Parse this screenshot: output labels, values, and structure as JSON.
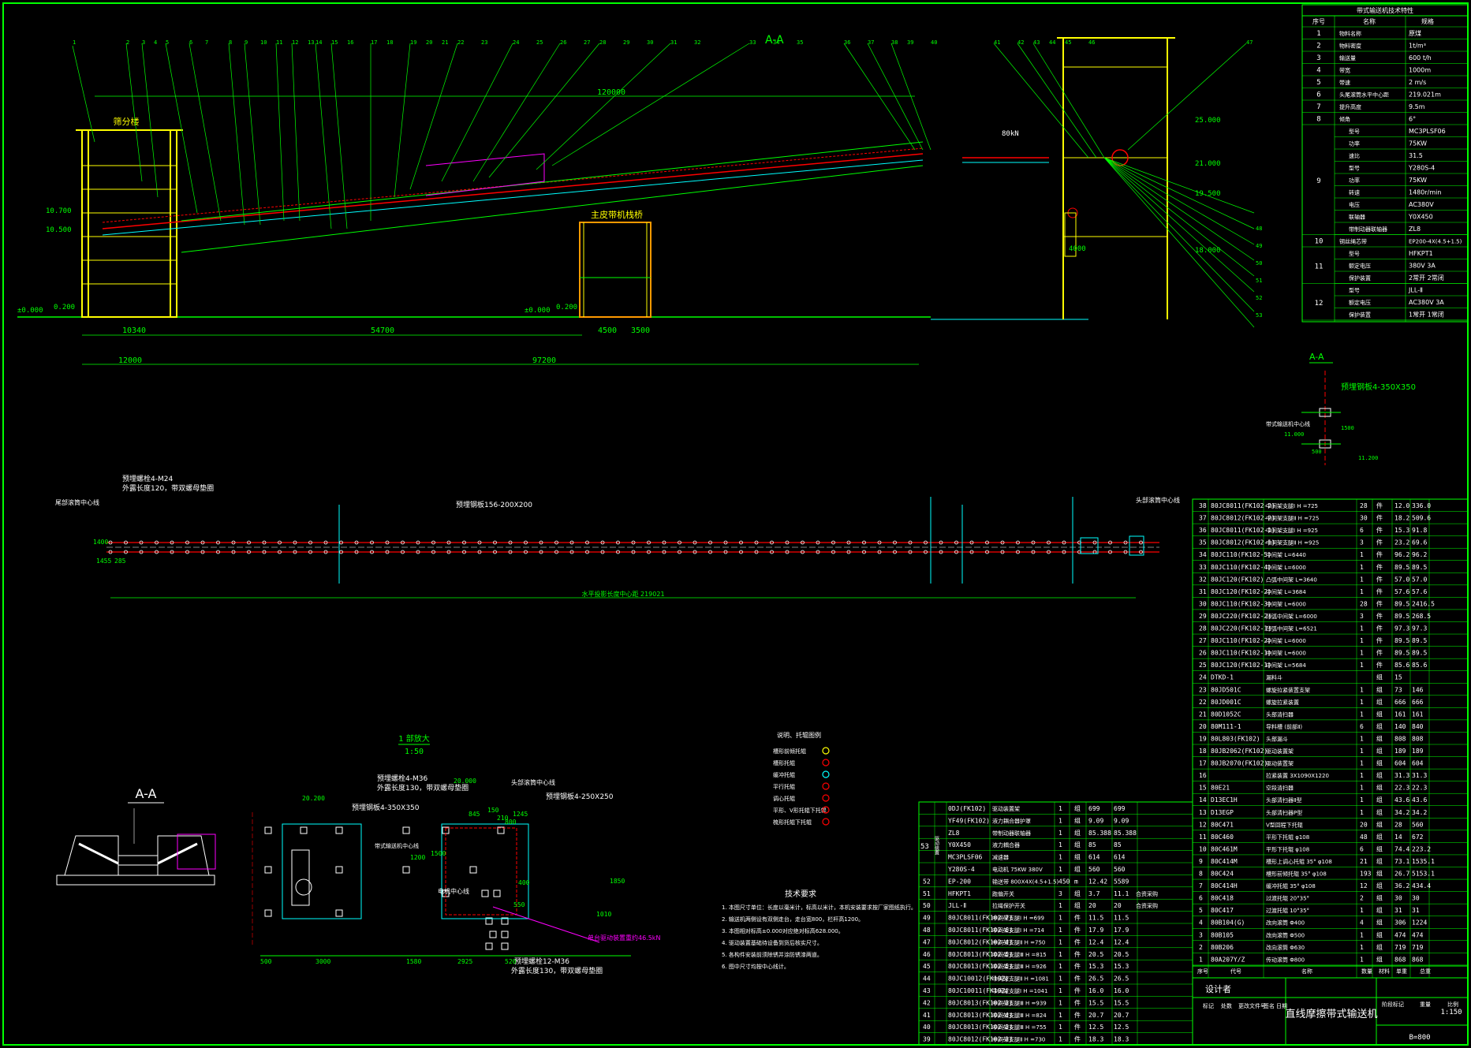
{
  "colors": {
    "background": "#000000",
    "green": "#00ff00",
    "yellow": "#ffff00",
    "cyan": "#00ffff",
    "red": "#ff0000",
    "white": "#ffffff",
    "magenta": "#ff00ff",
    "olive": "#c8c800",
    "orange": "#ff9900"
  },
  "elevation": {
    "section_label": "A-A",
    "dim_total": "120000",
    "load_label": "80kN",
    "floor_left": "±0.000",
    "floor_left2": "0.200",
    "floor_mid": "±0.000",
    "floor_mid2": "0.200",
    "elev_a": "10.700",
    "elev_b": "10.500",
    "elev_top": "25.000",
    "elev_r1": "21.000",
    "elev_r2": "19.500",
    "elev_r3": "18.000",
    "building_label": "筛分楼",
    "support_label": "主皮带机栈桥",
    "dim_10340": "10340",
    "dim_54700": "54700",
    "dim_4500": "4500",
    "dim_3500": "3500",
    "dim_12000": "12000",
    "dim_97200": "97200",
    "dim_4000": "4000",
    "callouts_top": [
      "1",
      "2",
      "3",
      "4",
      "5",
      "6",
      "7",
      "8",
      "9",
      "10",
      "11",
      "12",
      "13",
      "14",
      "15",
      "16",
      "17",
      "18",
      "19",
      "20",
      "21",
      "22",
      "23",
      "24",
      "25",
      "26",
      "27",
      "28",
      "29",
      "30",
      "31",
      "32",
      "33",
      "34",
      "35",
      "36",
      "37",
      "38",
      "39",
      "40",
      "41",
      "42",
      "43",
      "44",
      "45",
      "46",
      "47",
      "48",
      "49",
      "50",
      "51",
      "52",
      "53"
    ]
  },
  "plan": {
    "bolt_label": "预埋螺栓4-M24",
    "bolt_note": "外露长度120，带双螺母垫圈",
    "plate_label": "预埋钢板156-200X200",
    "left_center": "尾部滚筒中心线",
    "right_center": "头部滚筒中心线",
    "dim_total": "水平投影长度中心距 219021",
    "dim_1400": "1400",
    "dim_1455": "1455",
    "dim_285": "285"
  },
  "section_small": {
    "title": "A-A",
    "plate": "预埋钢板4-350X350",
    "center": "带式输送机中心线",
    "elev1": "11.000",
    "elev2": "11.200",
    "dim1500": "1500",
    "dim500": "500"
  },
  "details": {
    "aa_title": "A-A",
    "scale_title": "1 部放大",
    "scale": "1:50",
    "bolt_m36": "预埋螺栓4-M36",
    "bolt_m36_note": "外露长度130，带双螺母垫圈",
    "plate_350": "预埋钢板4-350X350",
    "plate_250": "预埋钢板4-250X250",
    "center_a": "头部滚筒中心线",
    "center_b": "带式输送机中心线",
    "center_c": "电机中心线",
    "bolt_12": "预埋螺栓12-M36",
    "bolt_12_note": "外露长度130，带双螺母垫圈",
    "load_note": "单台驱动装置重约46.5kN",
    "elev_20200": "20.200",
    "elev_20000": "20.000",
    "dims": [
      "500",
      "3000",
      "1580",
      "2925",
      "845",
      "1245",
      "1500",
      "1200",
      "1850",
      "1010",
      "550",
      "400",
      "520",
      "150",
      "210",
      "800"
    ]
  },
  "legend": {
    "title": "说明、托辊图例",
    "items": [
      "槽形前倾托辊",
      "槽形托辊",
      "缓冲托辊",
      "平行托辊",
      "调心托辊",
      "平形、V形托辊下托辊",
      "梳形托辊下托辊"
    ]
  },
  "tech": {
    "title": "技术要求",
    "lines": [
      "1. 本图尺寸单位：长度以毫米计，标高以米计，本机安装要求按厂家图纸执行。",
      "2. 输送机两侧设有双侧走台，走台宽800，栏杆高1200。",
      "3. 本图相对标高±0.000对应绝对标高628.000。",
      "4. 驱动装置基础待设备到货后核实尺寸。",
      "5. 各构件安装前须除锈并涂防锈漆两道。",
      "6. 图中尺寸均按中心线计。"
    ]
  },
  "spec_table": {
    "title": "带式输送机技术特性",
    "header": [
      "序号",
      "名称",
      "规格"
    ],
    "rows": [
      {
        "no": "1",
        "name": "物料名称",
        "spec": "原煤"
      },
      {
        "no": "2",
        "name": "物料密度",
        "spec": "1t/m³"
      },
      {
        "no": "3",
        "name": "输送量",
        "spec": "600 t/h"
      },
      {
        "no": "4",
        "name": "带宽",
        "spec": "1000m"
      },
      {
        "no": "5",
        "name": "带速",
        "spec": "2 m/s"
      },
      {
        "no": "6",
        "name": "头尾滚筒水平中心距",
        "spec": "219.021m"
      },
      {
        "no": "7",
        "name": "提升高度",
        "spec": "9.5m"
      },
      {
        "no": "8",
        "name": "倾角",
        "spec": "6°"
      }
    ],
    "row9": [
      {
        "sub": "型号",
        "spec": "MC3PLSF06"
      },
      {
        "sub": "功率",
        "spec": "75KW"
      },
      {
        "sub": "速比",
        "spec": "31.5"
      },
      {
        "sub": "型号",
        "spec": "Y280S-4"
      },
      {
        "sub": "功率",
        "spec": "75KW"
      },
      {
        "sub": "转速",
        "spec": "1480r/min"
      },
      {
        "sub": "电压",
        "spec": "AC380V"
      },
      {
        "sub": "联轴器",
        "spec": "Y0X450"
      },
      {
        "sub": "带制动器联轴器",
        "spec": "ZL8"
      }
    ],
    "row10": {
      "no": "10",
      "name": "钢丝绳芯带",
      "spec": "EP200-4X(4.5+1.5)"
    },
    "row11": [
      {
        "sub": "型号",
        "spec": "HFKPT1"
      },
      {
        "sub": "额定电压",
        "spec": "380V  3A"
      },
      {
        "sub": "保护装置",
        "spec": "2常开  2常闭"
      }
    ],
    "row12": [
      {
        "sub": "型号",
        "spec": "JLL-Ⅱ"
      },
      {
        "sub": "额定电压",
        "spec": "AC380V  3A"
      },
      {
        "sub": "保护装置",
        "spec": "1常开  1常闭"
      }
    ],
    "no9": "9",
    "no11": "11",
    "no12": "12"
  },
  "bom_right": {
    "rows": [
      [
        "38",
        "80JC8011(FK102-2)",
        "中间架支腿Ⅰ H =725",
        "28",
        "件",
        "12.0",
        "336.0"
      ],
      [
        "37",
        "80JC8012(FK102-2)",
        "中间架支腿Ⅱ H =725",
        "30",
        "件",
        "18.2",
        "509.6"
      ],
      [
        "36",
        "80JC8011(FK102-1)",
        "中间架支腿Ⅰ H =925",
        "6",
        "件",
        "15.3",
        "91.8"
      ],
      [
        "35",
        "80JC8012(FK102-1)",
        "中间架支腿Ⅱ H =925",
        "3",
        "件",
        "23.2",
        "69.6"
      ],
      [
        "34",
        "80JC110(FK102-5)",
        "中间架  L=6440",
        "1",
        "件",
        "96.2",
        "96.2"
      ],
      [
        "33",
        "80JC110(FK102-4)",
        "中间架  L=6000",
        "1",
        "件",
        "89.5",
        "89.5"
      ],
      [
        "32",
        "80JC120(FK102)",
        "凸弧中间架 L=3640",
        "1",
        "件",
        "57.0",
        "57.0"
      ],
      [
        "31",
        "80JC120(FK102-2)",
        "中间架  L=3684",
        "1",
        "件",
        "57.6",
        "57.6"
      ],
      [
        "30",
        "80JC110(FK102-3)",
        "中间架  L=6000",
        "28",
        "件",
        "89.5",
        "2416.5"
      ],
      [
        "29",
        "80JC220(FK102-2)",
        "凹弧中间架 L=6000",
        "3",
        "件",
        "89.5",
        "268.5"
      ],
      [
        "28",
        "80JC220(FK102-1)",
        "凹弧中间架 L=6521",
        "1",
        "件",
        "97.3",
        "97.3"
      ],
      [
        "27",
        "80JC110(FK102-2)",
        "中间架  L=6000",
        "1",
        "件",
        "89.5",
        "89.5"
      ],
      [
        "26",
        "80JC110(FK102-1)",
        "中间架  L=6000",
        "1",
        "件",
        "89.5",
        "89.5"
      ],
      [
        "25",
        "80JC120(FK102-1)",
        "中间架  L=5684",
        "1",
        "件",
        "85.6",
        "85.6"
      ],
      [
        "24",
        "DTKD-1",
        "漏料斗",
        "",
        "组",
        "15",
        ""
      ],
      [
        "23",
        "80JD501C",
        "螺旋拉紧装置支架",
        "1",
        "组",
        "73",
        "146"
      ],
      [
        "22",
        "80JD001C",
        "螺旋拉紧装置",
        "1",
        "组",
        "666",
        "666"
      ],
      [
        "21",
        "80D1052C",
        "头部清扫器",
        "1",
        "组",
        "161",
        "161"
      ],
      [
        "20",
        "80M111-1",
        "导料槽 (前部Ⅱ)",
        "6",
        "组",
        "140",
        "840"
      ],
      [
        "19",
        "80L803(FK102)",
        "头部漏斗",
        "1",
        "组",
        "808",
        "808"
      ],
      [
        "18",
        "80JB2062(FK102)",
        "驱动装置架",
        "1",
        "组",
        "189",
        "189"
      ],
      [
        "17",
        "80JB2070(FK102)",
        "驱动装置架",
        "1",
        "组",
        "604",
        "604"
      ],
      [
        "16",
        "",
        "拉紧装置  3X1090X1220",
        "1",
        "组",
        "31.3",
        "31.3"
      ],
      [
        "15",
        "80E21",
        "空段清扫器",
        "1",
        "组",
        "22.3",
        "22.3"
      ],
      [
        "14",
        "D13EC1H",
        "头部清扫器Ⅱ型",
        "1",
        "组",
        "43.6",
        "43.6"
      ],
      [
        "13",
        "D13EGP",
        "头部清扫器P型",
        "1",
        "组",
        "34.2",
        "34.2"
      ],
      [
        "12",
        "80C471",
        "V型回程下托辊",
        "20",
        "组",
        "28",
        "560"
      ],
      [
        "11",
        "80C460",
        "平形下托辊  φ108",
        "48",
        "组",
        "14",
        "672"
      ],
      [
        "10",
        "80C461M",
        "平形下托辊  φ108",
        "6",
        "组",
        "74.4",
        "223.2"
      ],
      [
        "9",
        "80C414M",
        "槽形上调心托辊 35° φ108",
        "21",
        "组",
        "73.1",
        "1535.1"
      ],
      [
        "8",
        "80C424",
        "槽形前倾托辊 35° φ108",
        "193",
        "组",
        "26.7",
        "5153.1"
      ],
      [
        "7",
        "80C414H",
        "缓冲托辊  35° φ108",
        "12",
        "组",
        "36.2",
        "434.4"
      ],
      [
        "6",
        "80C418",
        "过渡托辊 20°35°",
        "2",
        "组",
        "30",
        "30"
      ],
      [
        "5",
        "80C417",
        "过渡托辊 10°35°",
        "1",
        "组",
        "31",
        "31"
      ],
      [
        "4",
        "80B104(G)",
        "改向滚筒  Φ400",
        "4",
        "组",
        "306",
        "1224"
      ],
      [
        "3",
        "80B105",
        "改向滚筒  Φ500",
        "1",
        "组",
        "474",
        "474"
      ],
      [
        "2",
        "80B206",
        "改向滚筒  Φ630",
        "1",
        "组",
        "719",
        "719"
      ],
      [
        "1",
        "80A207Y/Z",
        "传动滚筒  Φ800",
        "1",
        "组",
        "868",
        "868"
      ]
    ],
    "footer": [
      "序号",
      "代号",
      "名称",
      "数量",
      "材料",
      "单重",
      "总重"
    ]
  },
  "bom_mid": {
    "group_no": "53",
    "group_name": "驱动装置",
    "rows": [
      [
        "",
        "0DJ(FK102)",
        "驱动装置架",
        "1",
        "组",
        "699",
        "699",
        ""
      ],
      [
        "",
        "YF49(FK102)",
        "液力耦合器护罩",
        "1",
        "组",
        "9.09",
        "9.09",
        ""
      ],
      [
        "",
        "ZL8",
        "带制动器联轴器",
        "1",
        "组",
        "85.388",
        "85.388",
        ""
      ],
      [
        "",
        "Y0X450",
        "液力耦合器",
        "1",
        "组",
        "85",
        "85",
        ""
      ],
      [
        "",
        "MC3PLSF06",
        "减速器",
        "1",
        "组",
        "614",
        "614",
        ""
      ],
      [
        "",
        "Y280S-4",
        "电动机  75KW  380V",
        "1",
        "组",
        "560",
        "560",
        ""
      ],
      [
        "52",
        "EP-200",
        "输送带 800X4X(4.5+1.5)",
        "450",
        "m",
        "12.42",
        "5589",
        ""
      ],
      [
        "51",
        "HFKPT1",
        "跑偏开关",
        "3",
        "组",
        "3.7",
        "11.1",
        "合资采购"
      ],
      [
        "50",
        "JLL-Ⅱ",
        "拉绳保护开关",
        "1",
        "组",
        "20",
        "20",
        "合资采购"
      ],
      [
        "49",
        "80JC8011(FK102-7)",
        "中间架支腿Ⅰ H =699",
        "1",
        "件",
        "11.5",
        "11.5",
        ""
      ],
      [
        "48",
        "80JC8011(FK102-6)",
        "中间架支腿Ⅰ H =714",
        "1",
        "件",
        "17.9",
        "17.9",
        ""
      ],
      [
        "47",
        "80JC8012(FK102-4)",
        "中间架支腿Ⅱ H =750",
        "1",
        "件",
        "12.4",
        "12.4",
        ""
      ],
      [
        "46",
        "80JC8013(FK102-5)",
        "中间架支腿Ⅲ H =815",
        "1",
        "件",
        "20.5",
        "20.5",
        ""
      ],
      [
        "45",
        "80JC8013(FK102-5)",
        "中间架支腿Ⅲ H =926",
        "1",
        "件",
        "15.3",
        "15.3",
        ""
      ],
      [
        "44",
        "80JC10012(FK102)",
        "中间架支腿Ⅱ H =1081",
        "1",
        "件",
        "26.5",
        "26.5",
        ""
      ],
      [
        "43",
        "80JC10011(FK102)",
        "中间架支腿Ⅰ H =1041",
        "1",
        "件",
        "16.0",
        "16.0",
        ""
      ],
      [
        "42",
        "80JC8013(FK102-3)",
        "中间架支腿Ⅲ H =939",
        "1",
        "件",
        "15.5",
        "15.5",
        ""
      ],
      [
        "41",
        "80JC8013(FK102-4)",
        "中间架支腿Ⅲ H =824",
        "1",
        "件",
        "20.7",
        "20.7",
        ""
      ],
      [
        "40",
        "80JC8013(FK102-3)",
        "中间架支腿Ⅲ H =755",
        "1",
        "件",
        "12.5",
        "12.5",
        ""
      ],
      [
        "39",
        "80JC8012(FK102-3)",
        "中间架支腿Ⅱ H =730",
        "1",
        "件",
        "18.3",
        "18.3",
        ""
      ]
    ]
  },
  "title_block": {
    "title": "直线摩擦带式输送机",
    "spec": "B=800",
    "scale": "1:150",
    "design_label": "设计者",
    "f1": "标记",
    "f2": "处数",
    "f3": "更改文件号",
    "f4": "签名",
    "f5": "日期",
    "f6": "阶段标记",
    "f7": "重量",
    "f8": "比例"
  }
}
